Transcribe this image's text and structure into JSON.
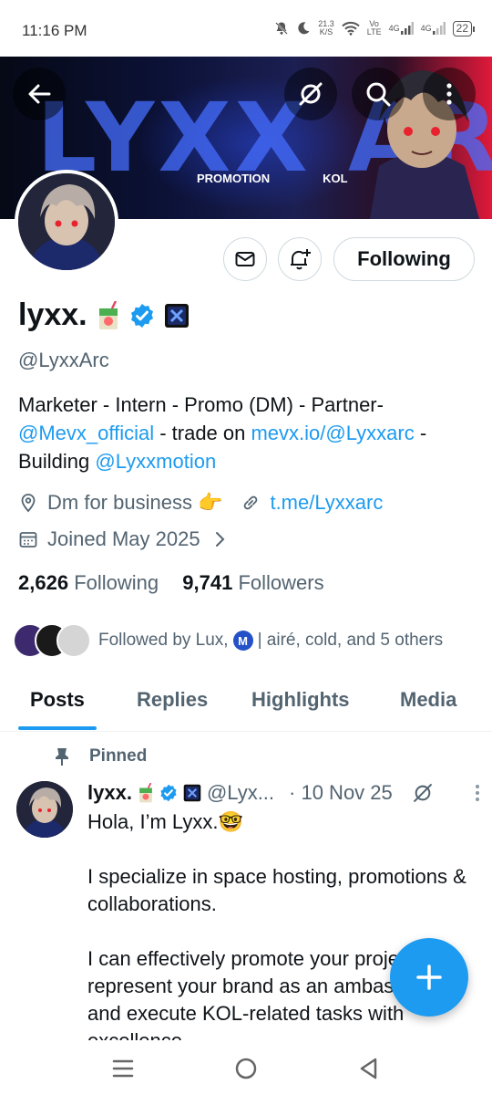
{
  "status_bar": {
    "time": "11:16 PM",
    "speed_value": "21.3",
    "speed_unit": "K/S",
    "volte_top": "Vo",
    "volte_bottom": "LTE",
    "net1": "4G",
    "net2": "4G",
    "battery": "22"
  },
  "banner": {
    "big_text": "LYXX ARC",
    "tag_promotion": "PROMOTION",
    "tag_kol": "KOL"
  },
  "profile": {
    "name": "lyxx.",
    "handle": "@LyxxArc",
    "bio_line1": "Marketer - Intern - Promo (DM) - Partner-",
    "bio_mention1": "@Mevx_official",
    "bio_mid": " - trade on ",
    "bio_link": "mevx.io/@Lyxxarc",
    "bio_dash": " -",
    "bio_building": "Building ",
    "bio_mention2": "@Lyxxmotion",
    "location": "Dm for business 👉",
    "website": "t.me/Lyxxarc",
    "joined": "Joined May 2025",
    "following_count": "2,626",
    "following_label": "Following",
    "followers_count": "9,741",
    "followers_label": "Followers",
    "followed_by_prefix": "Followed by Lux,",
    "followed_by_badge": "M",
    "followed_by_suffix": "| airé, cold, and 5 others",
    "following_button": "Following"
  },
  "tabs": [
    "Posts",
    "Replies",
    "Highlights",
    "Media"
  ],
  "post": {
    "pinned_label": "Pinned",
    "author": "lyxx.",
    "handle": "@Lyx...",
    "date": "· 10 Nov 25",
    "body": "Hola, I’m Lyxx.🤓\n\nI specialize in space hosting, promotions & collaborations.\n\nI can effectively promote your project, represent your brand as an ambassador, and execute KOL-related tasks with excellence."
  },
  "colors": {
    "accent": "#1d9bf0",
    "text": "#0f1419",
    "secondary": "#536471"
  }
}
